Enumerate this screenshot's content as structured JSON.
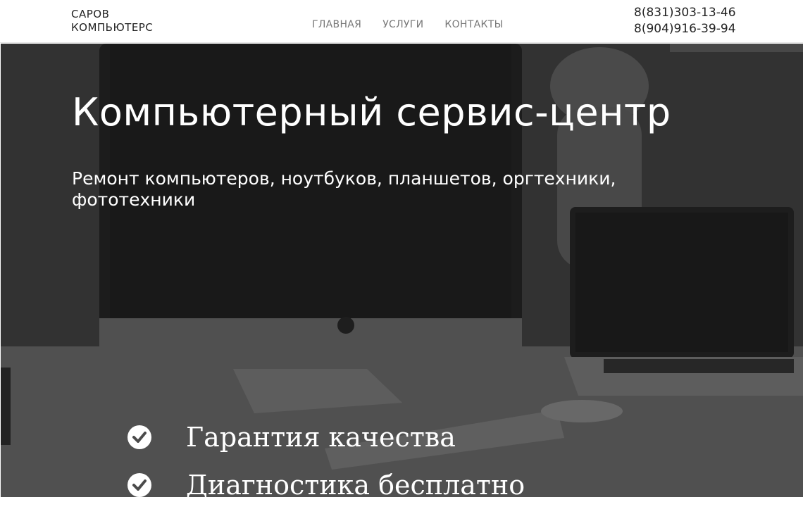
{
  "header": {
    "logo_line1": "САРОВ",
    "logo_line2": "КОМПЬЮТЕРС",
    "nav": [
      "ГЛАВНАЯ",
      "УСЛУГИ",
      "КОНТАКТЫ"
    ],
    "phones": [
      "8(831)303-13-46",
      "8(904)916-39-94"
    ]
  },
  "hero": {
    "title": "Компьютерный сервис-центр",
    "subtitle": "Ремонт компьютеров, ноутбуков, планшетов, оргтехники, фототехники",
    "features": [
      "Гарантия качества",
      "Диагностика бесплатно"
    ],
    "feature_icon": "check-circle-icon"
  }
}
